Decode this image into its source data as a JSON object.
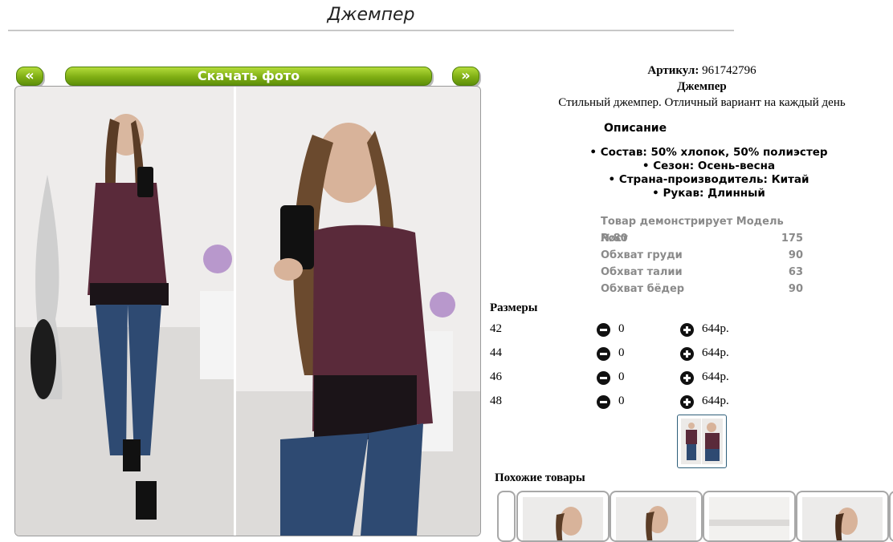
{
  "page": {
    "title": "Джемпер"
  },
  "gallery": {
    "prev_label": "«",
    "next_label": "»",
    "download_label": "Скачать фото"
  },
  "product": {
    "sku_label": "Артикул:",
    "sku": "961742796",
    "name": "Джемпер",
    "tagline": "Стильный джемпер. Отличный вариант на каждый день"
  },
  "description": {
    "heading": "Описание",
    "items": [
      "• Состав: 50% хлопок, 50% полиэстер",
      "• Сезон: Осень-весна",
      "• Страна-производитель: Китай",
      "• Рукав: Длинный"
    ]
  },
  "model": {
    "heading": "Товар демонстрирует Модель №80",
    "rows": [
      {
        "label": "Рост",
        "value": "175"
      },
      {
        "label": "Обхват груди",
        "value": "90"
      },
      {
        "label": "Обхват талии",
        "value": "63"
      },
      {
        "label": "Обхват бёдер",
        "value": "90"
      }
    ]
  },
  "sizes": {
    "heading": "Размеры",
    "rows": [
      {
        "size": "42",
        "qty": "0",
        "price": "644р."
      },
      {
        "size": "44",
        "qty": "0",
        "price": "644р."
      },
      {
        "size": "46",
        "qty": "0",
        "price": "644р."
      },
      {
        "size": "48",
        "qty": "0",
        "price": "644р."
      }
    ]
  },
  "similar": {
    "heading": "Похожие товары"
  },
  "colors": {
    "button_green": "#7fae14",
    "sweater": "#5a2a3a",
    "jeans": "#2e4a72"
  }
}
